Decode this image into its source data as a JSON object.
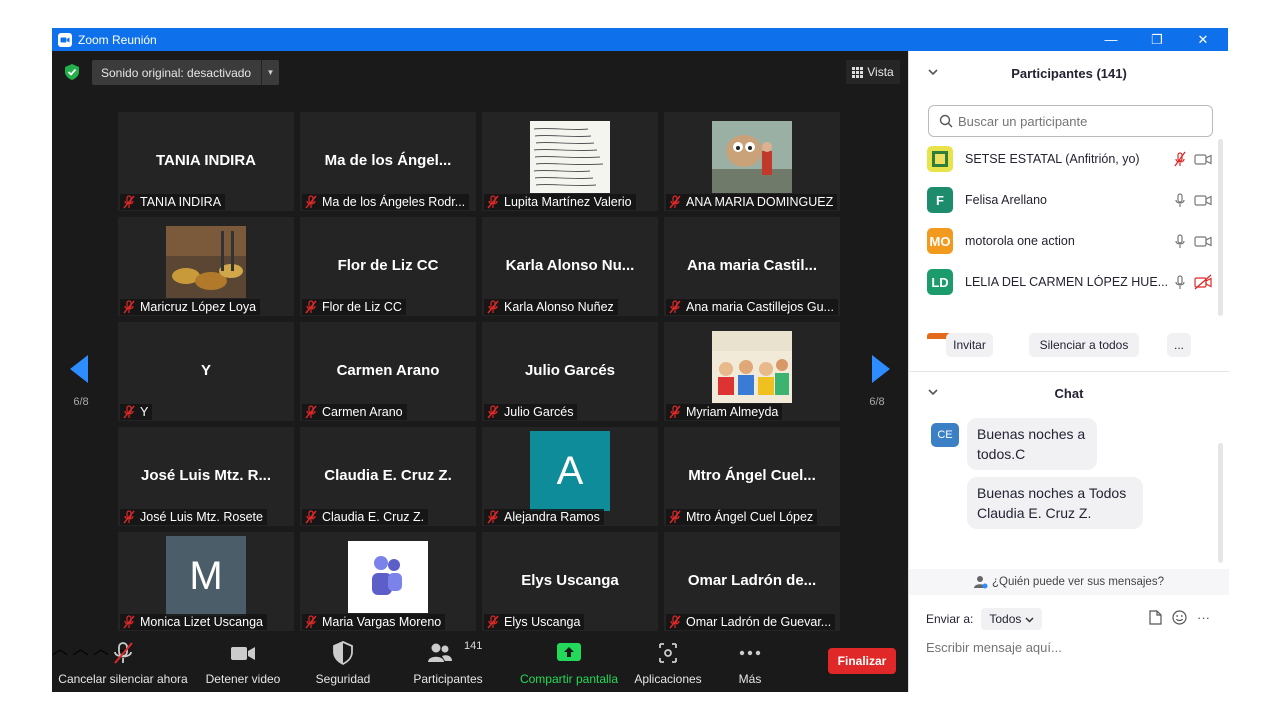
{
  "window": {
    "title": "Zoom Reunión",
    "minimize": "—",
    "maximize": "❐",
    "close": "✕"
  },
  "meeting_top": {
    "sound_button": "Sonido original: desactivado",
    "view_button": "Vista",
    "page_left": "6/8",
    "page_right": "6/8"
  },
  "tiles": [
    {
      "display": "TANIA INDIRA",
      "name": "TANIA INDIRA",
      "kind": "text"
    },
    {
      "display": "Ma de los Ángel...",
      "name": "Ma de los Ángeles Rodr...",
      "kind": "text"
    },
    {
      "display": "",
      "name": "Lupita Martínez Valerio",
      "kind": "note"
    },
    {
      "display": "",
      "name": "ANA MARIA DOMINGUEZ",
      "kind": "photo1"
    },
    {
      "display": "",
      "name": "Maricruz López Loya",
      "kind": "photo2"
    },
    {
      "display": "Flor de Liz CC",
      "name": "Flor de Liz CC",
      "kind": "text"
    },
    {
      "display": "Karla Alonso Nu...",
      "name": "Karla Alonso Nuñez",
      "kind": "text"
    },
    {
      "display": "Ana maria Castil...",
      "name": "Ana maria Castillejos Gu...",
      "kind": "text"
    },
    {
      "display": "Y",
      "name": "Y",
      "kind": "text"
    },
    {
      "display": "Carmen Arano",
      "name": "Carmen Arano",
      "kind": "text"
    },
    {
      "display": "Julio Garcés",
      "name": "Julio Garcés",
      "kind": "text"
    },
    {
      "display": "",
      "name": "Myriam Almeyda",
      "kind": "photo3"
    },
    {
      "display": "José Luis Mtz. R...",
      "name": "José Luis Mtz. Rosete",
      "kind": "text"
    },
    {
      "display": "Claudia E. Cruz Z.",
      "name": "Claudia E. Cruz Z.",
      "kind": "text"
    },
    {
      "display": "A",
      "name": "Alejandra Ramos",
      "kind": "letter",
      "color": "#0e8c9a"
    },
    {
      "display": "Mtro Ángel Cuel...",
      "name": "Mtro Ángel Cuel López",
      "kind": "text"
    },
    {
      "display": "M",
      "name": "Monica Lizet Uscanga",
      "kind": "letter",
      "color": "#4b5d68"
    },
    {
      "display": "",
      "name": "Maria Vargas Moreno",
      "kind": "teams"
    },
    {
      "display": "Elys Uscanga",
      "name": "Elys Uscanga",
      "kind": "text"
    },
    {
      "display": "Omar Ladrón de...",
      "name": "Omar Ladrón de Guevar...",
      "kind": "text"
    }
  ],
  "toolbar": {
    "unmute": "Cancelar silenciar ahora",
    "stop_video": "Detener video",
    "security": "Seguridad",
    "participants": "Participantes",
    "participants_count": "141",
    "share": "Compartir pantalla",
    "apps": "Aplicaciones",
    "more": "Más",
    "end": "Finalizar"
  },
  "participants_panel": {
    "title": "Participantes (141)",
    "search_placeholder": "Buscar un participante",
    "items": [
      {
        "initials": "",
        "name": "SETSE ESTATAL (Anfitrión, yo)",
        "color": "#e8e34a"
      },
      {
        "initials": "F",
        "name": "Felisa Arellano",
        "color": "#1c8c6c"
      },
      {
        "initials": "MO",
        "name": "motorola one action",
        "color": "#f29a1e"
      },
      {
        "initials": "LD",
        "name": "LELIA DEL CARMEN LÓPEZ HUE...",
        "color": "#1c9c6c"
      }
    ],
    "invite": "Invitar",
    "mute_all": "Silenciar a todos",
    "more": "..."
  },
  "chat": {
    "title": "Chat",
    "sender_initials": "CE",
    "messages": [
      "Buenas noches a todos.C",
      "Buenas noches a Todos Claudia E. Cruz Z."
    ],
    "who_can_see": "¿Quién puede ver sus mensajes?",
    "send_to_label": "Enviar a:",
    "send_to_value": "Todos",
    "input_placeholder": "Escribir mensaje aquí...",
    "more": "···"
  },
  "colors": {
    "titlebar": "#0e71eb",
    "share_green": "#23d959",
    "end_red": "#e02828"
  }
}
